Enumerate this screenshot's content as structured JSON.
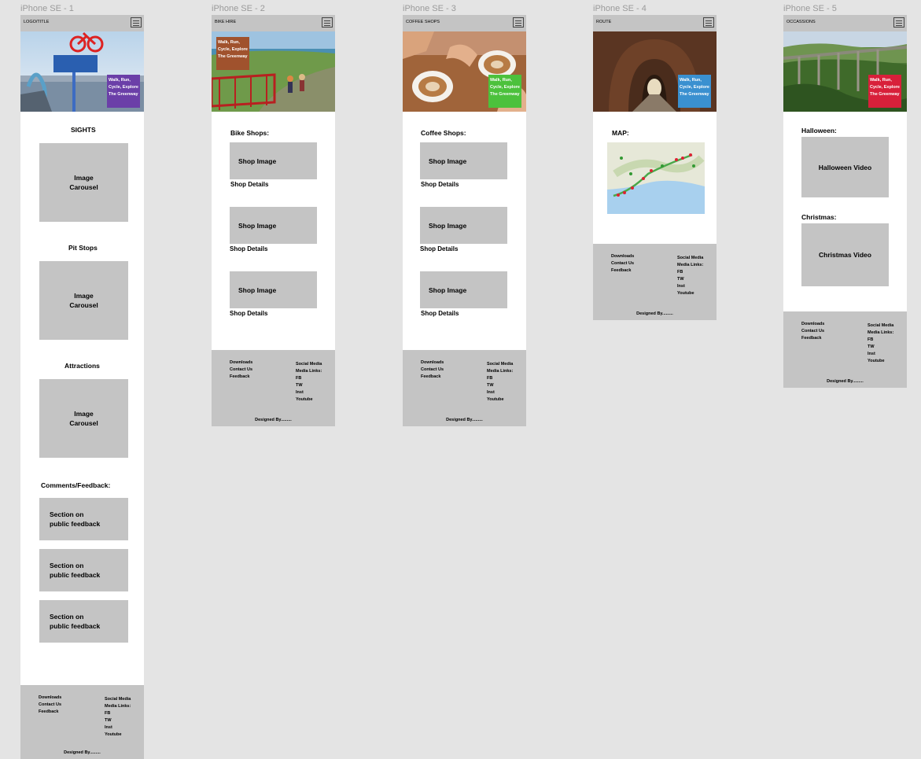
{
  "frames": [
    {
      "label": "iPhone SE - 1",
      "topbar_title": "LOGO/TITLE",
      "badge_text": [
        "Walk, Run,",
        "Cycle, Explore",
        "The Greenway"
      ],
      "sections": [
        "SIGHTS",
        "Pit Stops",
        "Attractions"
      ],
      "carousel_text": [
        "Image",
        "Carousel"
      ],
      "comments_heading": "Comments/Feedback:",
      "feedback_text": [
        "Section on",
        "public feedback"
      ]
    },
    {
      "label": "iPhone SE - 2",
      "topbar_title": "BIKE HIRE",
      "badge_text": [
        "Walk, Run,",
        "Cycle, Explore",
        "The Greenway"
      ],
      "heading": "Bike Shops:",
      "shop_image": "Shop Image",
      "shop_details": "Shop Details"
    },
    {
      "label": "iPhone SE - 3",
      "topbar_title": "COFFEE SHOPS",
      "badge_text": [
        "Walk, Run,",
        "Cycle, Explore",
        "The Greenway"
      ],
      "heading": "Coffee Shops:",
      "shop_image": "Shop Image",
      "shop_details": "Shop Details"
    },
    {
      "label": "iPhone SE - 4",
      "topbar_title": "ROUTE",
      "badge_text": [
        "Walk, Run,",
        "Cycle, Explore",
        "The Greenway"
      ],
      "heading": "MAP:"
    },
    {
      "label": "iPhone SE - 5",
      "topbar_title": "OCCASSIONS",
      "badge_text": [
        "Walk, Run,",
        "Cycle, Explore",
        "The Greenway"
      ],
      "halloween_heading": "Halloween:",
      "halloween_video": "Halloween Video",
      "christmas_heading": "Christmas:",
      "christmas_video": "Christmas Video"
    }
  ],
  "footer": {
    "links": [
      "Downloads",
      "Contact Us",
      "Feedback"
    ],
    "social": [
      "Social Media",
      "Media Links:",
      "FB",
      "TW",
      "Inst",
      "Youtube"
    ],
    "designed_by": "Designed By........."
  },
  "colors": {
    "canvas": "#e4e4e4",
    "placeholder": "#c4c4c4",
    "badge_1": "#6b3fa8",
    "badge_2": "#a0522d",
    "badge_3": "#4cc13c",
    "badge_4": "#3a90d0",
    "badge_5": "#d8203a"
  }
}
